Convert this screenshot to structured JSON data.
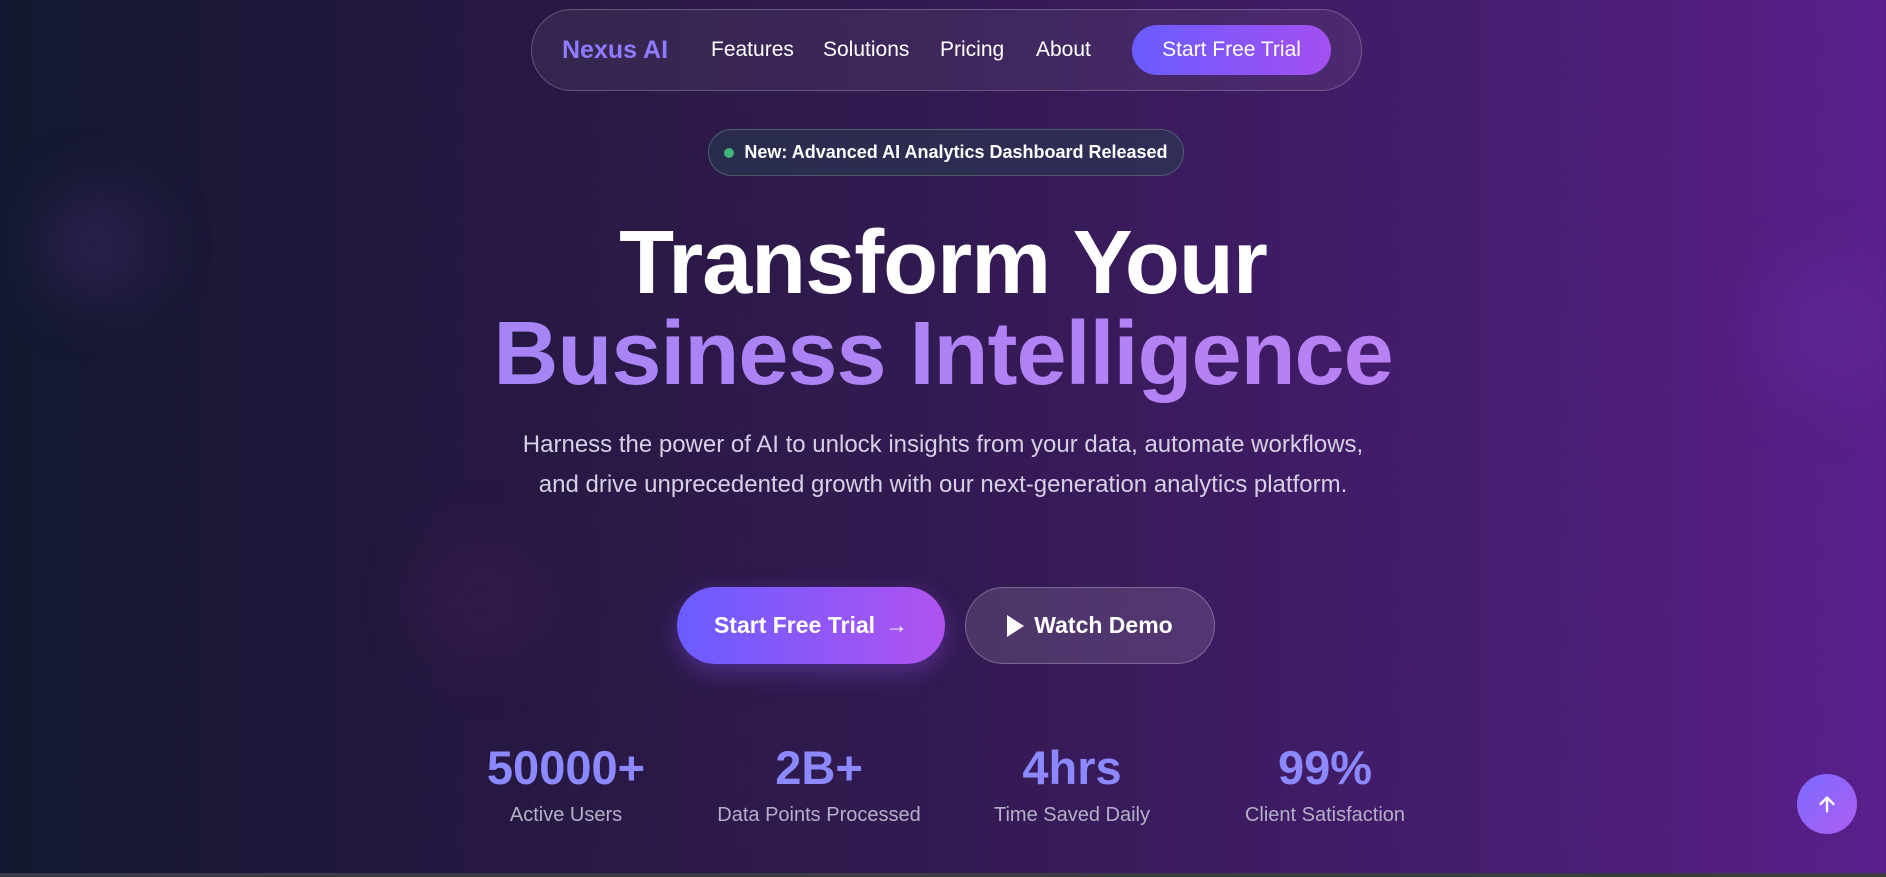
{
  "nav": {
    "brand": "Nexus AI",
    "links": [
      "Features",
      "Solutions",
      "Pricing",
      "About"
    ],
    "cta": "Start Free Trial"
  },
  "badge": {
    "text": "New: Advanced AI Analytics Dashboard Released",
    "dot_color": "#3fb37a"
  },
  "hero": {
    "headline_line1": "Transform Your",
    "headline_line2": "Business Intelligence",
    "subtitle": "Harness the power of AI to unlock insights from your data, automate workflows, and drive unprecedented growth with our next-generation analytics platform.",
    "primary_button": "Start Free Trial",
    "primary_arrow": "→",
    "secondary_button": "Watch Demo",
    "secondary_icon": "play-icon"
  },
  "stats": [
    {
      "value": "50000+",
      "label": "Active Users"
    },
    {
      "value": "2B+",
      "label": "Data Points Processed"
    },
    {
      "value": "4hrs",
      "label": "Time Saved Daily"
    },
    {
      "value": "99%",
      "label": "Client Satisfaction"
    }
  ],
  "scroll_top": {
    "icon": "arrow-up-icon"
  },
  "colors": {
    "accent": "#8f7bff",
    "gradient_start": "#6a5cff",
    "gradient_end": "#b053ef",
    "stat_value": "#8c89ff"
  }
}
